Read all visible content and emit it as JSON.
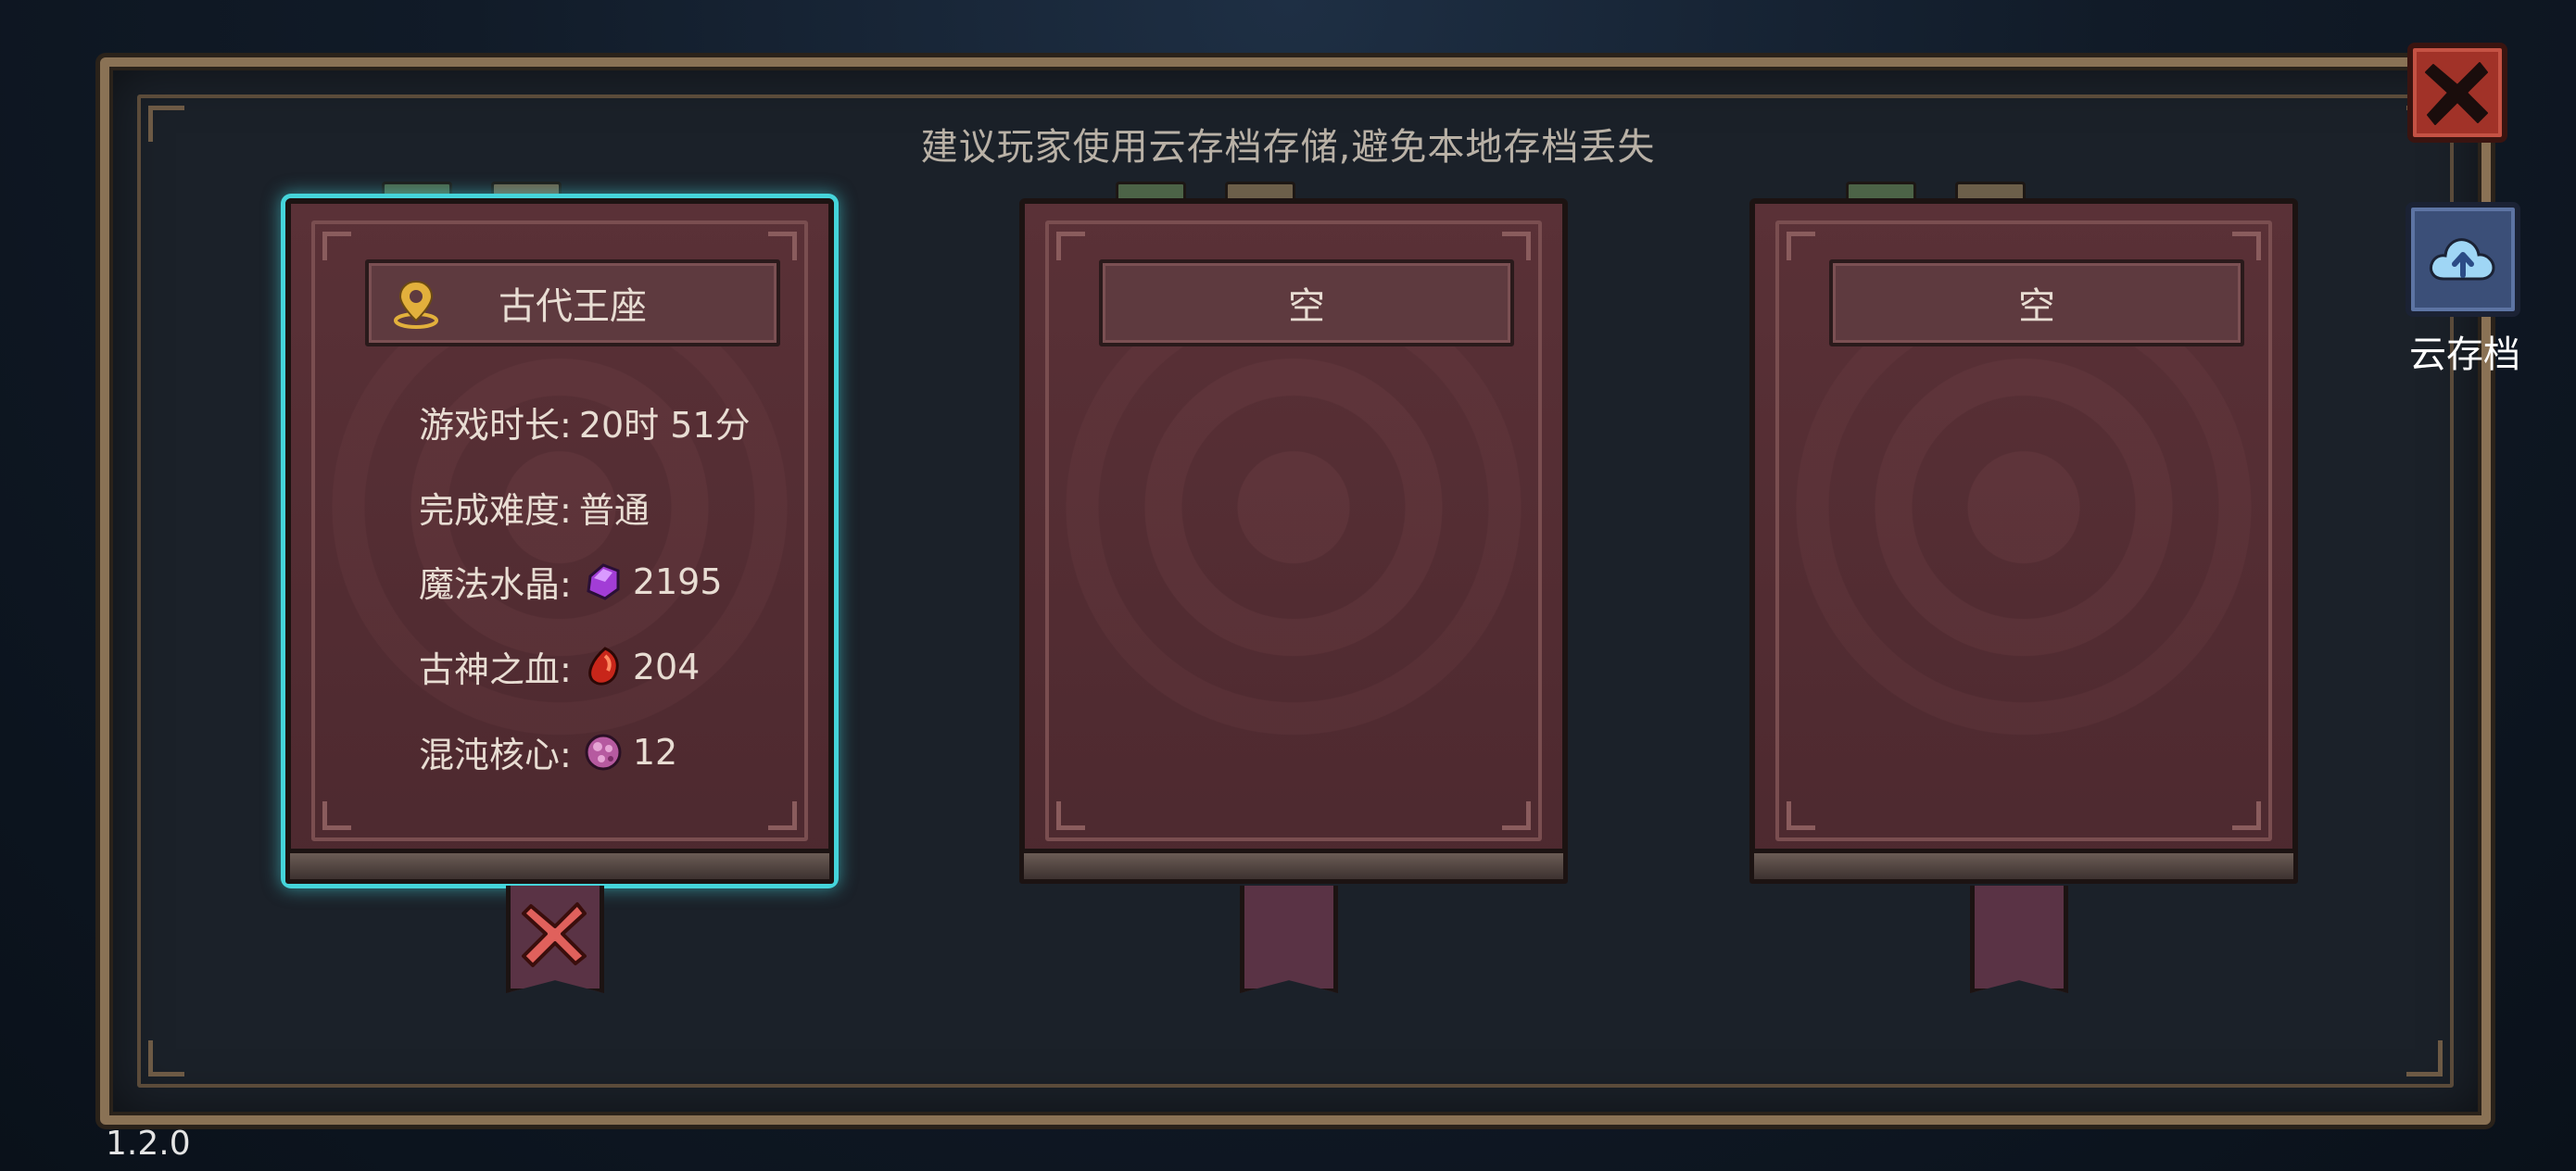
{
  "hint": "建议玩家使用云存档存储,避免本地存档丢失",
  "cloud_button": {
    "label": "云存档",
    "icon": "cloud-upload-icon"
  },
  "close_button": {
    "icon": "close-icon"
  },
  "version": "1.2.0",
  "slots": [
    {
      "title": "古代王座",
      "icon": "location-pin-icon",
      "stats": {
        "playtime_label": "游戏时长:",
        "playtime_value": "20时 51分",
        "difficulty_label": "完成难度:",
        "difficulty_value": "普通",
        "crystal_label": "魔法水晶:",
        "crystal_value": "2195",
        "blood_label": "古神之血:",
        "blood_value": "204",
        "chaos_label": "混沌核心:",
        "chaos_value": "12"
      },
      "selected": true,
      "delete_icon": "delete-x-icon"
    },
    {
      "title": "空"
    },
    {
      "title": "空"
    }
  ],
  "colors": {
    "selected_glow": "#45d4da",
    "close_red": "#a13228",
    "cloud_blue": "#3b4f78"
  }
}
